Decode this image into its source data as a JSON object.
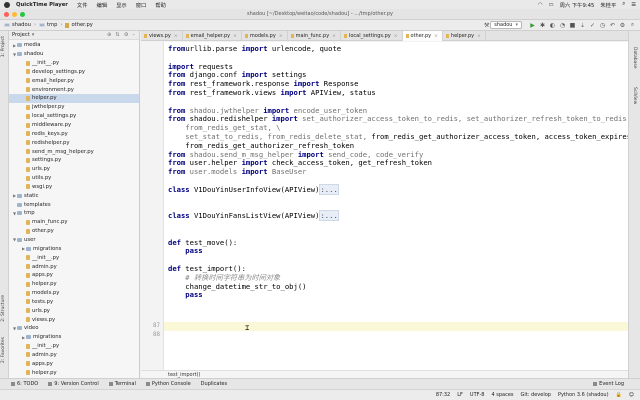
{
  "menubar": {
    "app_name": "QuickTime Player",
    "items": [
      "文件",
      "编辑",
      "显示",
      "窗口",
      "帮助"
    ],
    "clock": "周六 下午9:45",
    "user": "朱桂平"
  },
  "window": {
    "title": "shadou [~/Desktop/weitao/code/shadou] - .../tmp/other.py"
  },
  "navbar": {
    "crumbs": [
      "shadou",
      "tmp",
      "other.py"
    ],
    "run_config": "shadou"
  },
  "project": {
    "label": "Project",
    "side_label": "1: Project",
    "tree": [
      {
        "indent": 0,
        "arrow": "▸",
        "icon": "folder",
        "label": "media"
      },
      {
        "indent": 0,
        "arrow": "▾",
        "icon": "folder",
        "label": "shadou"
      },
      {
        "indent": 1,
        "arrow": "",
        "icon": "init",
        "label": "__init__.py"
      },
      {
        "indent": 1,
        "arrow": "",
        "icon": "py",
        "label": "develop_settings.py"
      },
      {
        "indent": 1,
        "arrow": "",
        "icon": "py",
        "label": "email_helper.py"
      },
      {
        "indent": 1,
        "arrow": "",
        "icon": "py",
        "label": "environment.py"
      },
      {
        "indent": 1,
        "arrow": "",
        "icon": "py",
        "label": "helper.py",
        "selected": true
      },
      {
        "indent": 1,
        "arrow": "",
        "icon": "py",
        "label": "jwthelper.py"
      },
      {
        "indent": 1,
        "arrow": "",
        "icon": "py",
        "label": "local_settings.py"
      },
      {
        "indent": 1,
        "arrow": "",
        "icon": "py",
        "label": "middleware.py"
      },
      {
        "indent": 1,
        "arrow": "",
        "icon": "py",
        "label": "redis_keys.py"
      },
      {
        "indent": 1,
        "arrow": "",
        "icon": "py",
        "label": "redishelper.py"
      },
      {
        "indent": 1,
        "arrow": "",
        "icon": "py",
        "label": "send_m_msg_helper.py"
      },
      {
        "indent": 1,
        "arrow": "",
        "icon": "py",
        "label": "settings.py"
      },
      {
        "indent": 1,
        "arrow": "",
        "icon": "py",
        "label": "urls.py"
      },
      {
        "indent": 1,
        "arrow": "",
        "icon": "py",
        "label": "utils.py"
      },
      {
        "indent": 1,
        "arrow": "",
        "icon": "py",
        "label": "wsgi.py"
      },
      {
        "indent": 0,
        "arrow": "▸",
        "icon": "folder",
        "label": "static"
      },
      {
        "indent": 0,
        "arrow": "",
        "icon": "folder",
        "label": "templates"
      },
      {
        "indent": 0,
        "arrow": "▾",
        "icon": "folder",
        "label": "tmp"
      },
      {
        "indent": 1,
        "arrow": "",
        "icon": "py",
        "label": "main_func.py"
      },
      {
        "indent": 1,
        "arrow": "",
        "icon": "py",
        "label": "other.py"
      },
      {
        "indent": 0,
        "arrow": "▾",
        "icon": "folder",
        "label": "user"
      },
      {
        "indent": 1,
        "arrow": "▸",
        "icon": "folder",
        "label": "migrations"
      },
      {
        "indent": 1,
        "arrow": "",
        "icon": "init",
        "label": "__init__.py"
      },
      {
        "indent": 1,
        "arrow": "",
        "icon": "py",
        "label": "admin.py"
      },
      {
        "indent": 1,
        "arrow": "",
        "icon": "py",
        "label": "apps.py"
      },
      {
        "indent": 1,
        "arrow": "",
        "icon": "py",
        "label": "helper.py"
      },
      {
        "indent": 1,
        "arrow": "",
        "icon": "py",
        "label": "models.py"
      },
      {
        "indent": 1,
        "arrow": "",
        "icon": "py",
        "label": "tests.py"
      },
      {
        "indent": 1,
        "arrow": "",
        "icon": "py",
        "label": "urls.py"
      },
      {
        "indent": 1,
        "arrow": "",
        "icon": "py",
        "label": "views.py"
      },
      {
        "indent": 0,
        "arrow": "▾",
        "icon": "folder",
        "label": "video"
      },
      {
        "indent": 1,
        "arrow": "▸",
        "icon": "folder",
        "label": "migrations"
      },
      {
        "indent": 1,
        "arrow": "",
        "icon": "init",
        "label": "__init__.py"
      },
      {
        "indent": 1,
        "arrow": "",
        "icon": "py",
        "label": "admin.py"
      },
      {
        "indent": 1,
        "arrow": "",
        "icon": "py",
        "label": "apps.py"
      },
      {
        "indent": 1,
        "arrow": "",
        "icon": "py",
        "label": "helper.py"
      }
    ]
  },
  "tabs": [
    {
      "label": "views.py",
      "active": false
    },
    {
      "label": "email_helper.py",
      "active": false
    },
    {
      "label": "models.py",
      "active": false
    },
    {
      "label": "main_func.py",
      "active": false
    },
    {
      "label": "local_settings.py",
      "active": false
    },
    {
      "label": "other.py",
      "active": true
    },
    {
      "label": "helper.py",
      "active": false
    }
  ],
  "editor": {
    "line_numbers": {
      "87": "87",
      "88": "88"
    },
    "lines": [
      {
        "row": 0,
        "parts": [
          [
            "kw",
            "from"
          ],
          [
            "",
            "urllib.parse "
          ],
          [
            "kw",
            "import"
          ],
          [
            "",
            " urlencode, quote"
          ]
        ]
      },
      {
        "row": 2,
        "parts": [
          [
            "kw",
            "import"
          ],
          [
            "",
            " requests"
          ]
        ]
      },
      {
        "row": 3,
        "parts": [
          [
            "kw",
            "from"
          ],
          [
            "",
            " django.conf "
          ],
          [
            "kw",
            "import"
          ],
          [
            "",
            " settings"
          ]
        ]
      },
      {
        "row": 4,
        "parts": [
          [
            "kw",
            "from"
          ],
          [
            "",
            " rest_framework.response "
          ],
          [
            "kw",
            "import"
          ],
          [
            "",
            " Response"
          ]
        ]
      },
      {
        "row": 5,
        "parts": [
          [
            "kw",
            "from"
          ],
          [
            "",
            " rest_framework.views "
          ],
          [
            "kw",
            "import"
          ],
          [
            "",
            " APIView, status"
          ]
        ]
      },
      {
        "row": 7,
        "parts": [
          [
            "kw",
            "from"
          ],
          [
            "gr",
            " shadou.jwthelper "
          ],
          [
            "kw",
            "import"
          ],
          [
            "gr",
            " encode_user_token"
          ]
        ]
      },
      {
        "row": 8,
        "parts": [
          [
            "kw",
            "from"
          ],
          [
            "",
            " shadou.redishelper "
          ],
          [
            "kw",
            "import"
          ],
          [
            "gr",
            " set_authorizer_access_token_to_redis, set_authorizer_refresh_token_to_redis,"
          ]
        ]
      },
      {
        "row": 9,
        "parts": [
          [
            "gr",
            "    from_redis_get_stat, \\"
          ]
        ]
      },
      {
        "row": 10,
        "parts": [
          [
            "gr",
            "    set_stat_to_redis, from_redis_delete_stat, "
          ],
          [
            "",
            "from_redis_get_authorizer_access_token, access_token_expires"
          ]
        ]
      },
      {
        "row": 11,
        "parts": [
          [
            "",
            "    from_redis_get_authorizer_refresh_token"
          ]
        ]
      },
      {
        "row": 12,
        "parts": [
          [
            "kw",
            "from"
          ],
          [
            "gr",
            " shadou.send_m_msg_helper "
          ],
          [
            "kw",
            "import"
          ],
          [
            "gr",
            " send_code, code_verify"
          ]
        ]
      },
      {
        "row": 13,
        "parts": [
          [
            "kw",
            "from"
          ],
          [
            "",
            " user.helper "
          ],
          [
            "kw",
            "import"
          ],
          [
            "",
            " check_access_token, get_refresh_token"
          ]
        ]
      },
      {
        "row": 14,
        "parts": [
          [
            "kw",
            "from"
          ],
          [
            "gr",
            " user.models "
          ],
          [
            "kw",
            "import"
          ],
          [
            "gr",
            " BaseUser"
          ]
        ]
      },
      {
        "row": 16,
        "parts": [
          [
            "kw",
            "class"
          ],
          [
            "",
            " V1DouYinUserInfoView(APIView)"
          ],
          [
            "fold",
            ":..."
          ]
        ]
      },
      {
        "row": 19,
        "parts": [
          [
            "kw",
            "class"
          ],
          [
            "",
            " V1DouYinFansListView(APIView)"
          ],
          [
            "fold",
            ":..."
          ]
        ]
      },
      {
        "row": 22,
        "parts": [
          [
            "kw",
            "def"
          ],
          [
            "",
            " test_move():"
          ]
        ]
      },
      {
        "row": 23,
        "parts": [
          [
            "kw",
            "    pass"
          ]
        ]
      },
      {
        "row": 25,
        "parts": [
          [
            "kw",
            "def"
          ],
          [
            "",
            " test_import():"
          ]
        ]
      },
      {
        "row": 26,
        "parts": [
          [
            "cm",
            "    # 转换时间字符串为时间对象"
          ]
        ]
      },
      {
        "row": 27,
        "parts": [
          [
            "",
            "    change_datetime_str_to_obj()"
          ]
        ]
      },
      {
        "row": 28,
        "parts": [
          [
            "kw",
            "    pass"
          ]
        ]
      }
    ]
  },
  "crumb_bottom": "test_import()",
  "right_labels": [
    "Database",
    "SciView"
  ],
  "left_labels": [
    "2: Structure",
    "2: Favorites"
  ],
  "bottom_tools": [
    "6: TODO",
    "9: Version Control",
    "Terminal",
    "Python Console",
    "Duplicates"
  ],
  "event_log": "Event Log",
  "status": {
    "position": "87:32",
    "line_sep": "LF",
    "encoding": "UTF-8",
    "indent": "4 spaces",
    "vcs": "Git: develop",
    "interpreter": "Python 3.6 (shadou)"
  },
  "colors": {
    "keyword": "#000080",
    "selection": "#c9d8ea",
    "caret_line": "#fbf8d7"
  }
}
